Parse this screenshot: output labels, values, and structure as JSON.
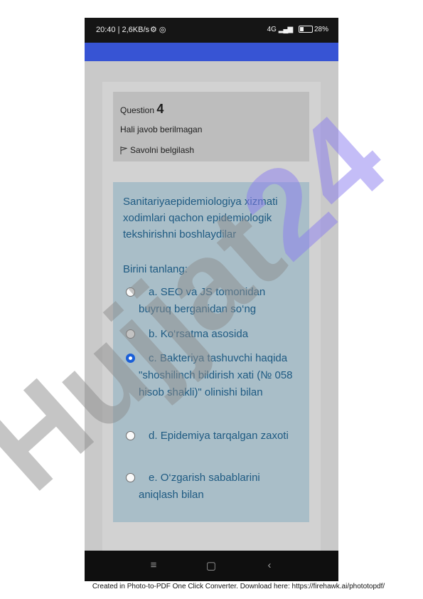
{
  "status_bar": {
    "time_speed": "20:40 | 2,6KB/s",
    "network": "4G",
    "battery": "28"
  },
  "question": {
    "label": "Question",
    "number": "4",
    "status": "Hali javob berilmagan",
    "flag_label": "Savolni belgilash",
    "text": "Sanitariyaepidemiologiya xizmati xodimlari qachon epidemiologik tekshirishni boshlaydilar",
    "prompt": "Birini tanlang:",
    "options": [
      {
        "letter": "a.",
        "text": "SEO va JS tomonidan buyruq berganidan so‘ng",
        "selected": false
      },
      {
        "letter": "b.",
        "text": "Ko‘rsatma asosida",
        "selected": false
      },
      {
        "letter": "c.",
        "text": "Bakteriya tashuvchi haqida \"shoshilinch bildirish xati (№ 058 hisob shakli)\" olinishi bilan",
        "selected": true
      },
      {
        "letter": "d.",
        "text": "Epidemiya tarqalgan zaxoti",
        "selected": false
      },
      {
        "letter": "e.",
        "text": "O‘zgarish sabablarini aniqlash bilan",
        "selected": false
      }
    ]
  },
  "watermark": {
    "text": "Hujjat24",
    "color": "#8a7cf0"
  },
  "footer": "Created in Photo-to-PDF One Click Converter. Download here: https://firehawk.ai/phototopdf/",
  "colors": {
    "header": "#3754d4",
    "question_text": "#1e5a82",
    "selected_radio": "#1a5fd8"
  }
}
